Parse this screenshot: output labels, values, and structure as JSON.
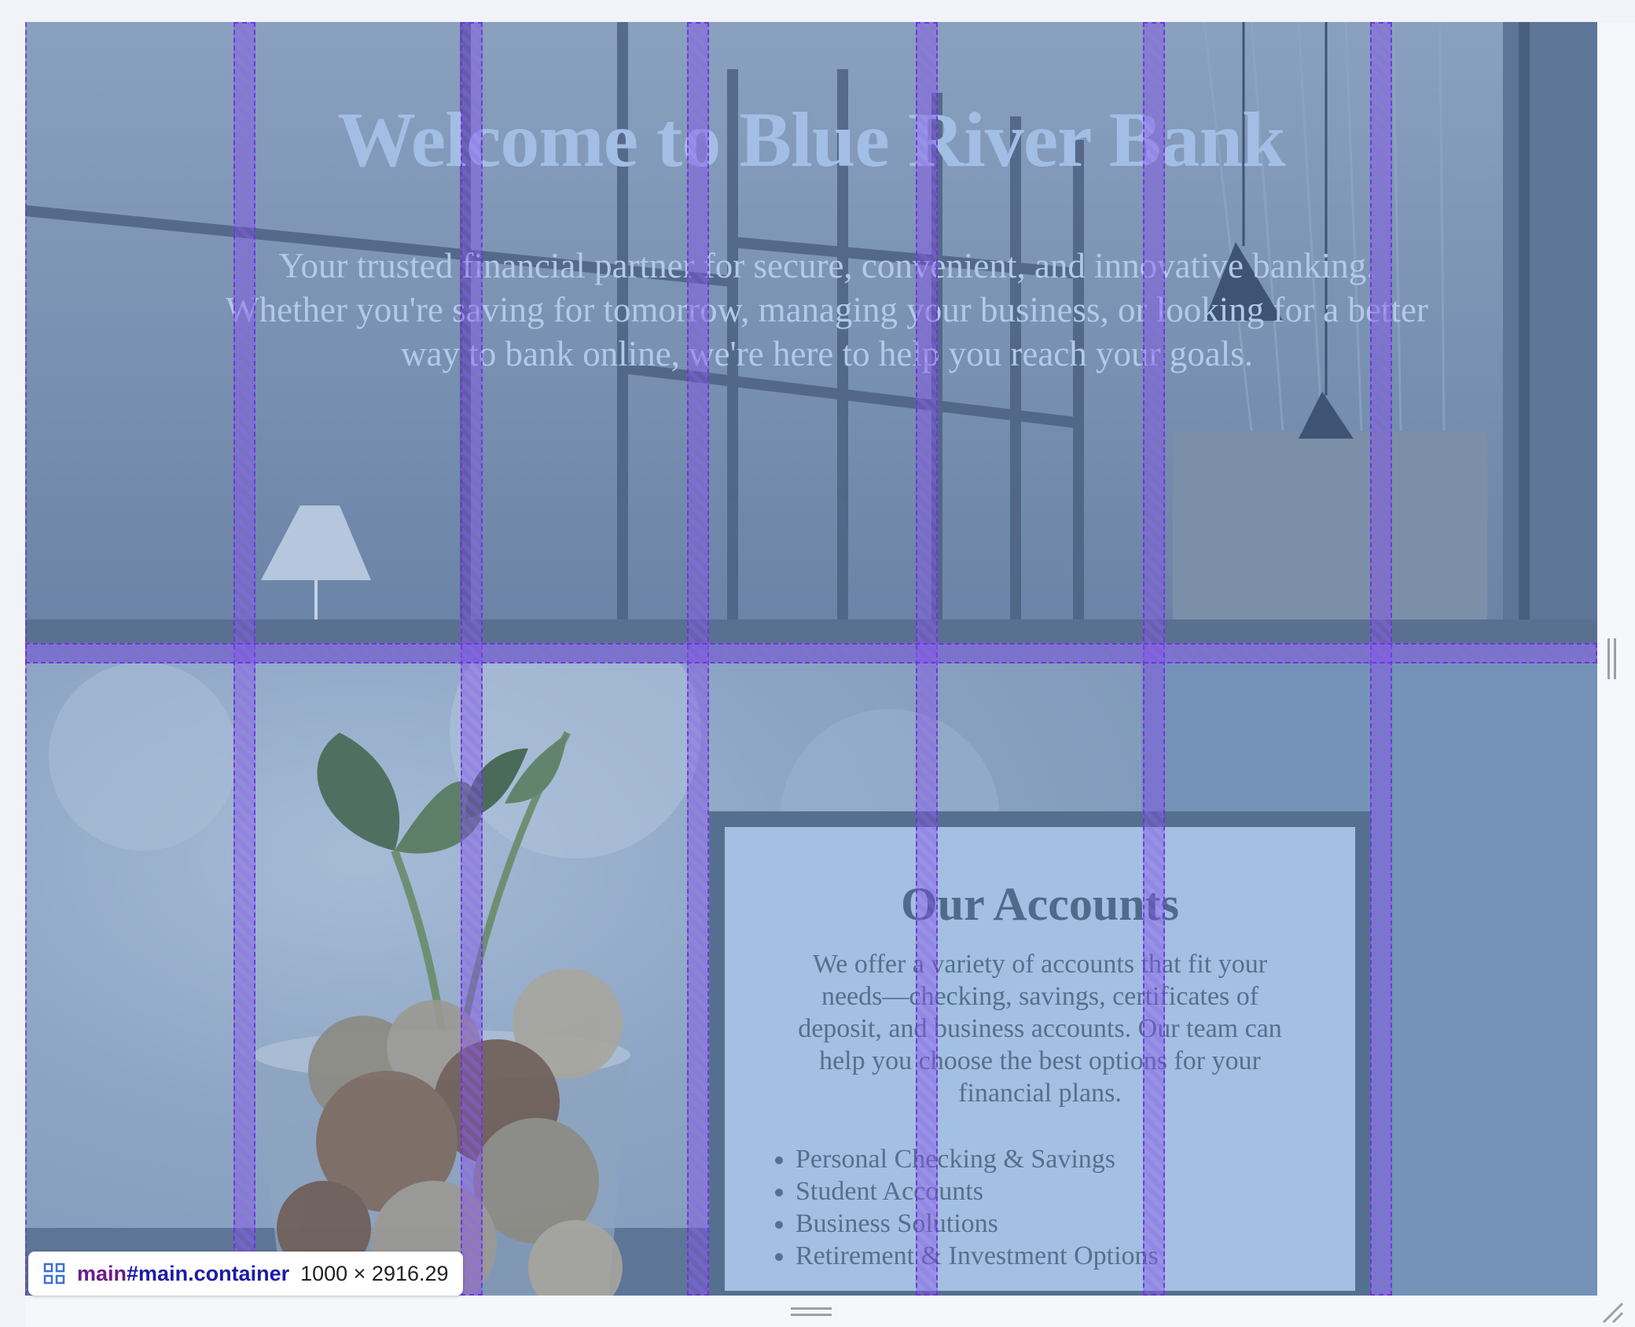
{
  "hero": {
    "title": "Welcome to Blue River Bank",
    "text": "Your trusted financial partner for secure, convenient, and innovative banking. Whether you're saving for tomorrow, managing your business, or looking for a better way to bank online, we're here to help you reach your goals."
  },
  "accounts": {
    "title": "Our Accounts",
    "text": "We offer a variety of accounts that fit your needs—checking, savings, certificates of deposit, and business accounts. Our team can help you choose the best options for your financial plans.",
    "items": [
      "Personal Checking & Savings",
      "Student Accounts",
      "Business Solutions",
      "Retirement & Investment Options"
    ]
  },
  "devtools": {
    "element_tag": "main",
    "element_selector": "#main.container",
    "element_size": "1000 × 2916.29",
    "grid_icon": "grid-layout-icon"
  },
  "colors": {
    "grid_overlay": "#8a56ee",
    "hero_title": "#a3bee4",
    "card_background": "#a3bfe1",
    "card_border": "#55708f"
  }
}
